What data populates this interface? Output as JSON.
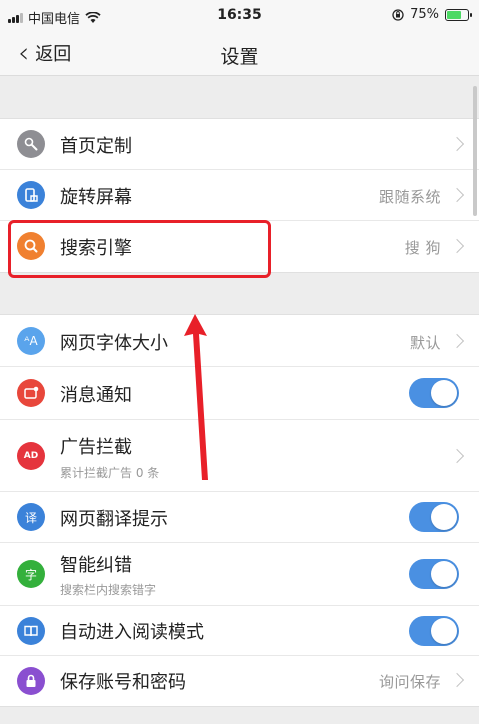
{
  "status_bar": {
    "carrier": "中国电信",
    "time": "16:35",
    "battery": "75%",
    "battery_level": 0.75
  },
  "nav": {
    "back_label": "返回",
    "title": "设置"
  },
  "group1": [
    {
      "label": "首页定制",
      "icon": "wrench-icon",
      "icon_color": "#8e8e93"
    },
    {
      "label": "旋转屏幕",
      "value": "跟随系统",
      "icon": "rotate-screen-icon",
      "icon_color": "#3b82d9"
    },
    {
      "label": "搜索引擎",
      "value": "搜 狗",
      "icon": "search-icon",
      "icon_color": "#f08030"
    }
  ],
  "group2": [
    {
      "label": "网页字体大小",
      "value": "默认",
      "icon": "font-size-icon",
      "icon_glyph": "ᴬA",
      "icon_color": "#5aa4ec"
    },
    {
      "label": "消息通知",
      "toggle": true,
      "icon": "message-icon",
      "icon_color": "#e8473b"
    },
    {
      "label": "广告拦截",
      "sub": "累计拦截广告 0 条",
      "icon": "ad-block-icon",
      "icon_glyph": "AD",
      "icon_color": "#e5343d"
    },
    {
      "label": "网页翻译提示",
      "toggle": true,
      "icon": "translate-icon",
      "icon_glyph": "译",
      "icon_color": "#3b82d9"
    },
    {
      "label": "智能纠错",
      "sub": "搜索栏内搜索错字",
      "toggle": true,
      "icon": "correction-icon",
      "icon_glyph": "字",
      "icon_color": "#34b03c"
    },
    {
      "label": "自动进入阅读模式",
      "toggle": true,
      "icon": "book-icon",
      "icon_color": "#3b82d9"
    },
    {
      "label": "保存账号和密码",
      "value": "询问保存",
      "icon": "lock-icon",
      "icon_color": "#8a4fd0"
    }
  ],
  "colors": {
    "toggle_on": "#4a90e2",
    "highlight": "#e82029"
  }
}
